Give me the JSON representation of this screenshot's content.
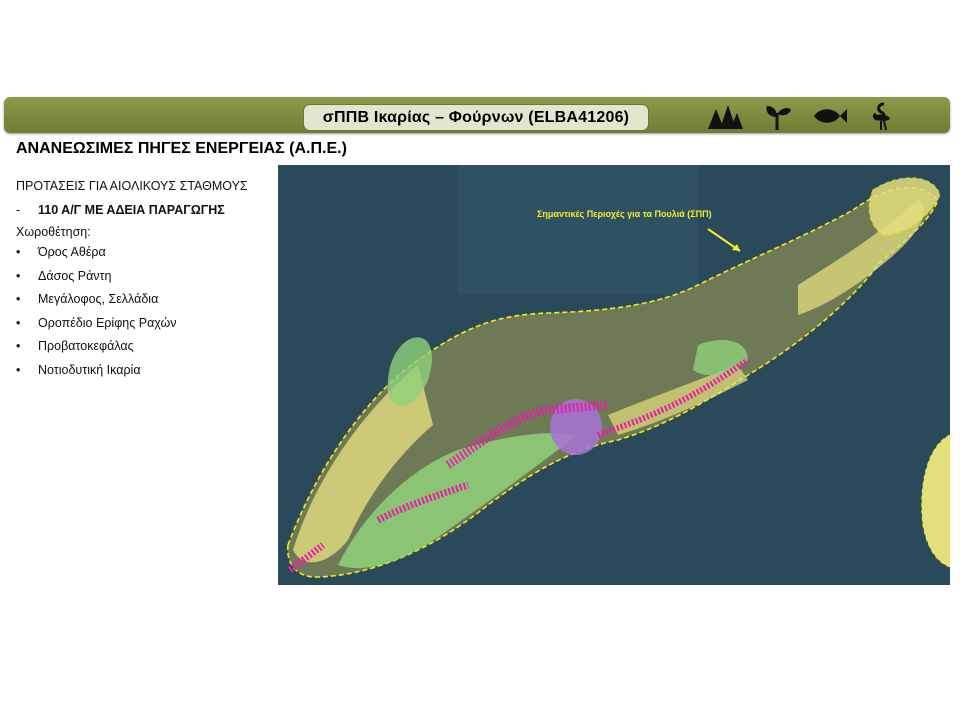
{
  "header": {
    "title": "σΠΠΒ Ικαρίας – Φούρνων (ELBA41206)",
    "icons": [
      "trees-icon",
      "plant-icon",
      "fish-icon",
      "flamingo-icon"
    ]
  },
  "section_title": "ΑΝΑΝΕΩΣΙΜΕΣ ΠΗΓΕΣ ΕΝΕΡΓΕΙΑΣ (Α.Π.Ε.)",
  "body": {
    "proposals_label": "ΠΡΟΤΑΣΕΙΣ ΓΙΑ ΑΙΟΛΙΚΟΥΣ ΣΤΑΘΜΟΥΣ",
    "dash": "-",
    "licensed_turbines": "110 Α/Γ ΜΕ ΑΔΕΙΑ ΠΑΡΑΓΩΓΗΣ",
    "siting_label": "Χωροθέτηση:",
    "bullet": "•",
    "locations": [
      "Όρος Αθέρα",
      "Δάσος Ράντη",
      "Μεγάλοφος, Σελλάδια",
      "Οροπέδιο Ερίφης Ραχών",
      "Προβατοκεφάλας",
      "Νοτιοδυτική Ικαρία"
    ]
  },
  "map": {
    "annotation": "Σημαντικές Περιοχές για τα Πουλιά (ΣΠΠ)",
    "colors": {
      "sea": "#2a4a5c",
      "land": "#6e7a55",
      "zone_yellow": "#e4df7e",
      "zone_green": "#8fd17a",
      "wind_magenta": "#e61ea8",
      "zone_purple": "#a873d6",
      "boundary": "#f5ea1a"
    }
  }
}
